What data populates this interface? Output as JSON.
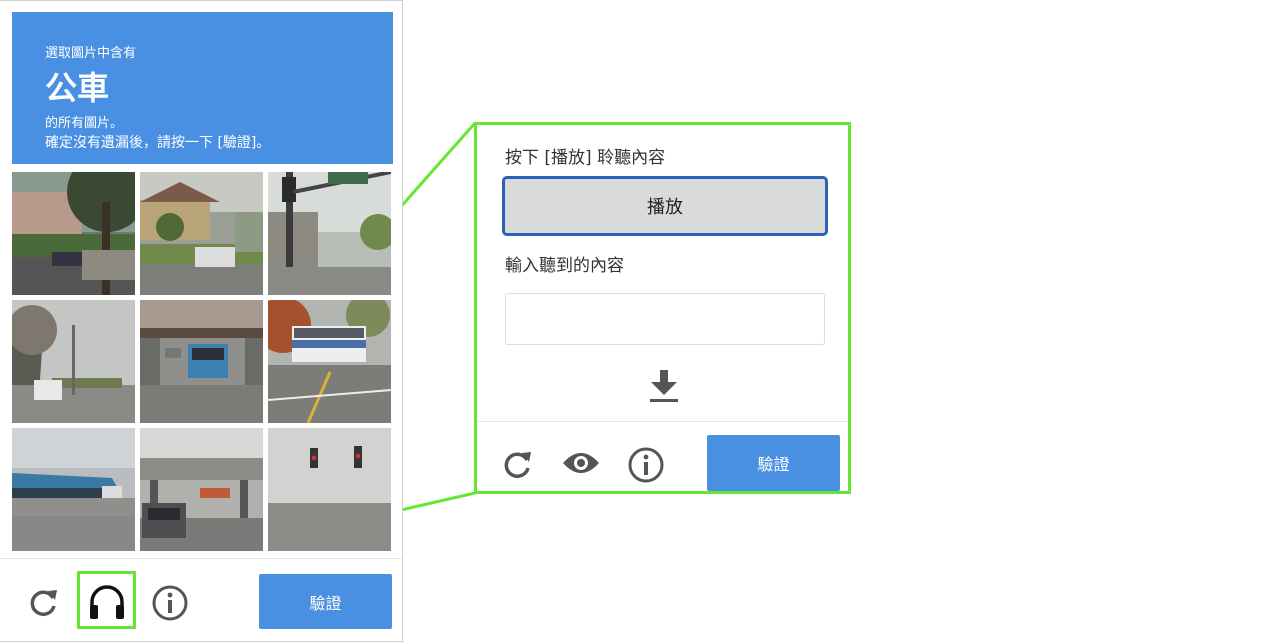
{
  "captcha": {
    "prompt_pre": "選取圖片中含有",
    "prompt_target": "公車",
    "prompt_post": "的所有圖片。",
    "prompt_instruction": "確定沒有遺漏後，請按一下 [驗證]。",
    "verify_label": "驗證",
    "icons": [
      "reload-icon",
      "headphones-icon",
      "info-icon"
    ]
  },
  "audio_panel": {
    "play_instruction": "按下 [播放] 聆聽內容",
    "play_label": "播放",
    "input_label": "輸入聽到的內容",
    "input_value": "",
    "verify_label": "驗證",
    "icons": [
      "download-icon",
      "reload-icon",
      "eye-icon",
      "info-icon"
    ]
  },
  "colors": {
    "accent_blue": "#4a90e2",
    "highlight_green": "#66e632",
    "play_border": "#2a62b8"
  }
}
